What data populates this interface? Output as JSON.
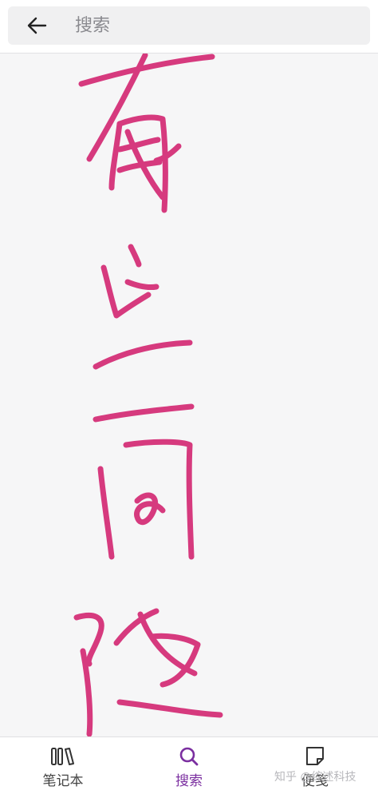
{
  "header": {
    "back_icon": "arrow-left-icon",
    "search": {
      "placeholder": "搜索",
      "value": ""
    }
  },
  "canvas": {
    "ink_color": "#d63a7e",
    "background": "#f6f6f7"
  },
  "bottom_nav": {
    "items": [
      {
        "label": "笔记本",
        "icon": "notebooks-icon",
        "active": false
      },
      {
        "label": "搜索",
        "icon": "search-icon",
        "active": true
      },
      {
        "label": "便笺",
        "icon": "sticky-note-icon",
        "active": false
      }
    ],
    "accent_color": "#7b2fa0"
  },
  "watermark": {
    "text": "知乎 @综述科技"
  }
}
